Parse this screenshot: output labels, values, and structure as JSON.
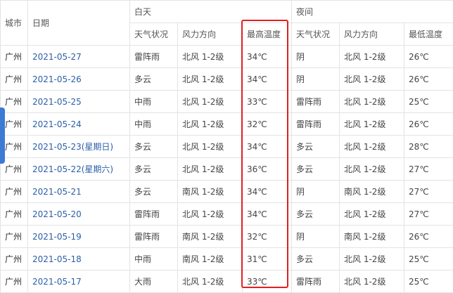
{
  "header": {
    "city": "城市",
    "date": "日期",
    "day_group": "白天",
    "night_group": "夜间",
    "day_cols": [
      "天气状况",
      "风力方向",
      "最高温度"
    ],
    "night_cols": [
      "天气状况",
      "风力方向",
      "最低温度"
    ]
  },
  "rows": [
    {
      "city": "广州",
      "date": "2021-05-27",
      "day_weather": "雷阵雨",
      "day_wind": "北风 1-2级",
      "high": "34℃",
      "night_weather": "阴",
      "night_wind": "北风 1-2级",
      "low": "26℃"
    },
    {
      "city": "广州",
      "date": "2021-05-26",
      "day_weather": "多云",
      "day_wind": "北风 1-2级",
      "high": "34℃",
      "night_weather": "阴",
      "night_wind": "北风 1-2级",
      "low": "26℃"
    },
    {
      "city": "广州",
      "date": "2021-05-25",
      "day_weather": "中雨",
      "day_wind": "北风 1-2级",
      "high": "33℃",
      "night_weather": "雷阵雨",
      "night_wind": "北风 1-2级",
      "low": "25℃"
    },
    {
      "city": "广州",
      "date": "2021-05-24",
      "day_weather": "中雨",
      "day_wind": "北风 1-2级",
      "high": "32℃",
      "night_weather": "雷阵雨",
      "night_wind": "北风 1-2级",
      "low": "26℃"
    },
    {
      "city": "广州",
      "date": "2021-05-23(星期日)",
      "day_weather": "多云",
      "day_wind": "北风 1-2级",
      "high": "34℃",
      "night_weather": "多云",
      "night_wind": "北风 1-2级",
      "low": "28℃"
    },
    {
      "city": "广州",
      "date": "2021-05-22(星期六)",
      "day_weather": "多云",
      "day_wind": "北风 1-2级",
      "high": "36℃",
      "night_weather": "多云",
      "night_wind": "北风 1-2级",
      "low": "27℃"
    },
    {
      "city": "广州",
      "date": "2021-05-21",
      "day_weather": "多云",
      "day_wind": "南风 1-2级",
      "high": "34℃",
      "night_weather": "阴",
      "night_wind": "南风 1-2级",
      "low": "27℃"
    },
    {
      "city": "广州",
      "date": "2021-05-20",
      "day_weather": "雷阵雨",
      "day_wind": "北风 1-2级",
      "high": "34℃",
      "night_weather": "多云",
      "night_wind": "北风 1-2级",
      "low": "27℃"
    },
    {
      "city": "广州",
      "date": "2021-05-19",
      "day_weather": "雷阵雨",
      "day_wind": "南风 1-2级",
      "high": "32℃",
      "night_weather": "阴",
      "night_wind": "南风 1-2级",
      "low": "26℃"
    },
    {
      "city": "广州",
      "date": "2021-05-18",
      "day_weather": "中雨",
      "day_wind": "南风 1-2级",
      "high": "31℃",
      "night_weather": "多云",
      "night_wind": "北风 1-2级",
      "low": "25℃"
    },
    {
      "city": "广州",
      "date": "2021-05-17",
      "day_weather": "大雨",
      "day_wind": "北风 1-2级",
      "high": "33℃",
      "night_weather": "雷阵雨",
      "night_wind": "北风 1-2级",
      "low": "25℃"
    }
  ],
  "colors": {
    "date_link": "#2a5ea8",
    "highlight_border": "#e02020",
    "side_tab": "#3d7ad6"
  }
}
